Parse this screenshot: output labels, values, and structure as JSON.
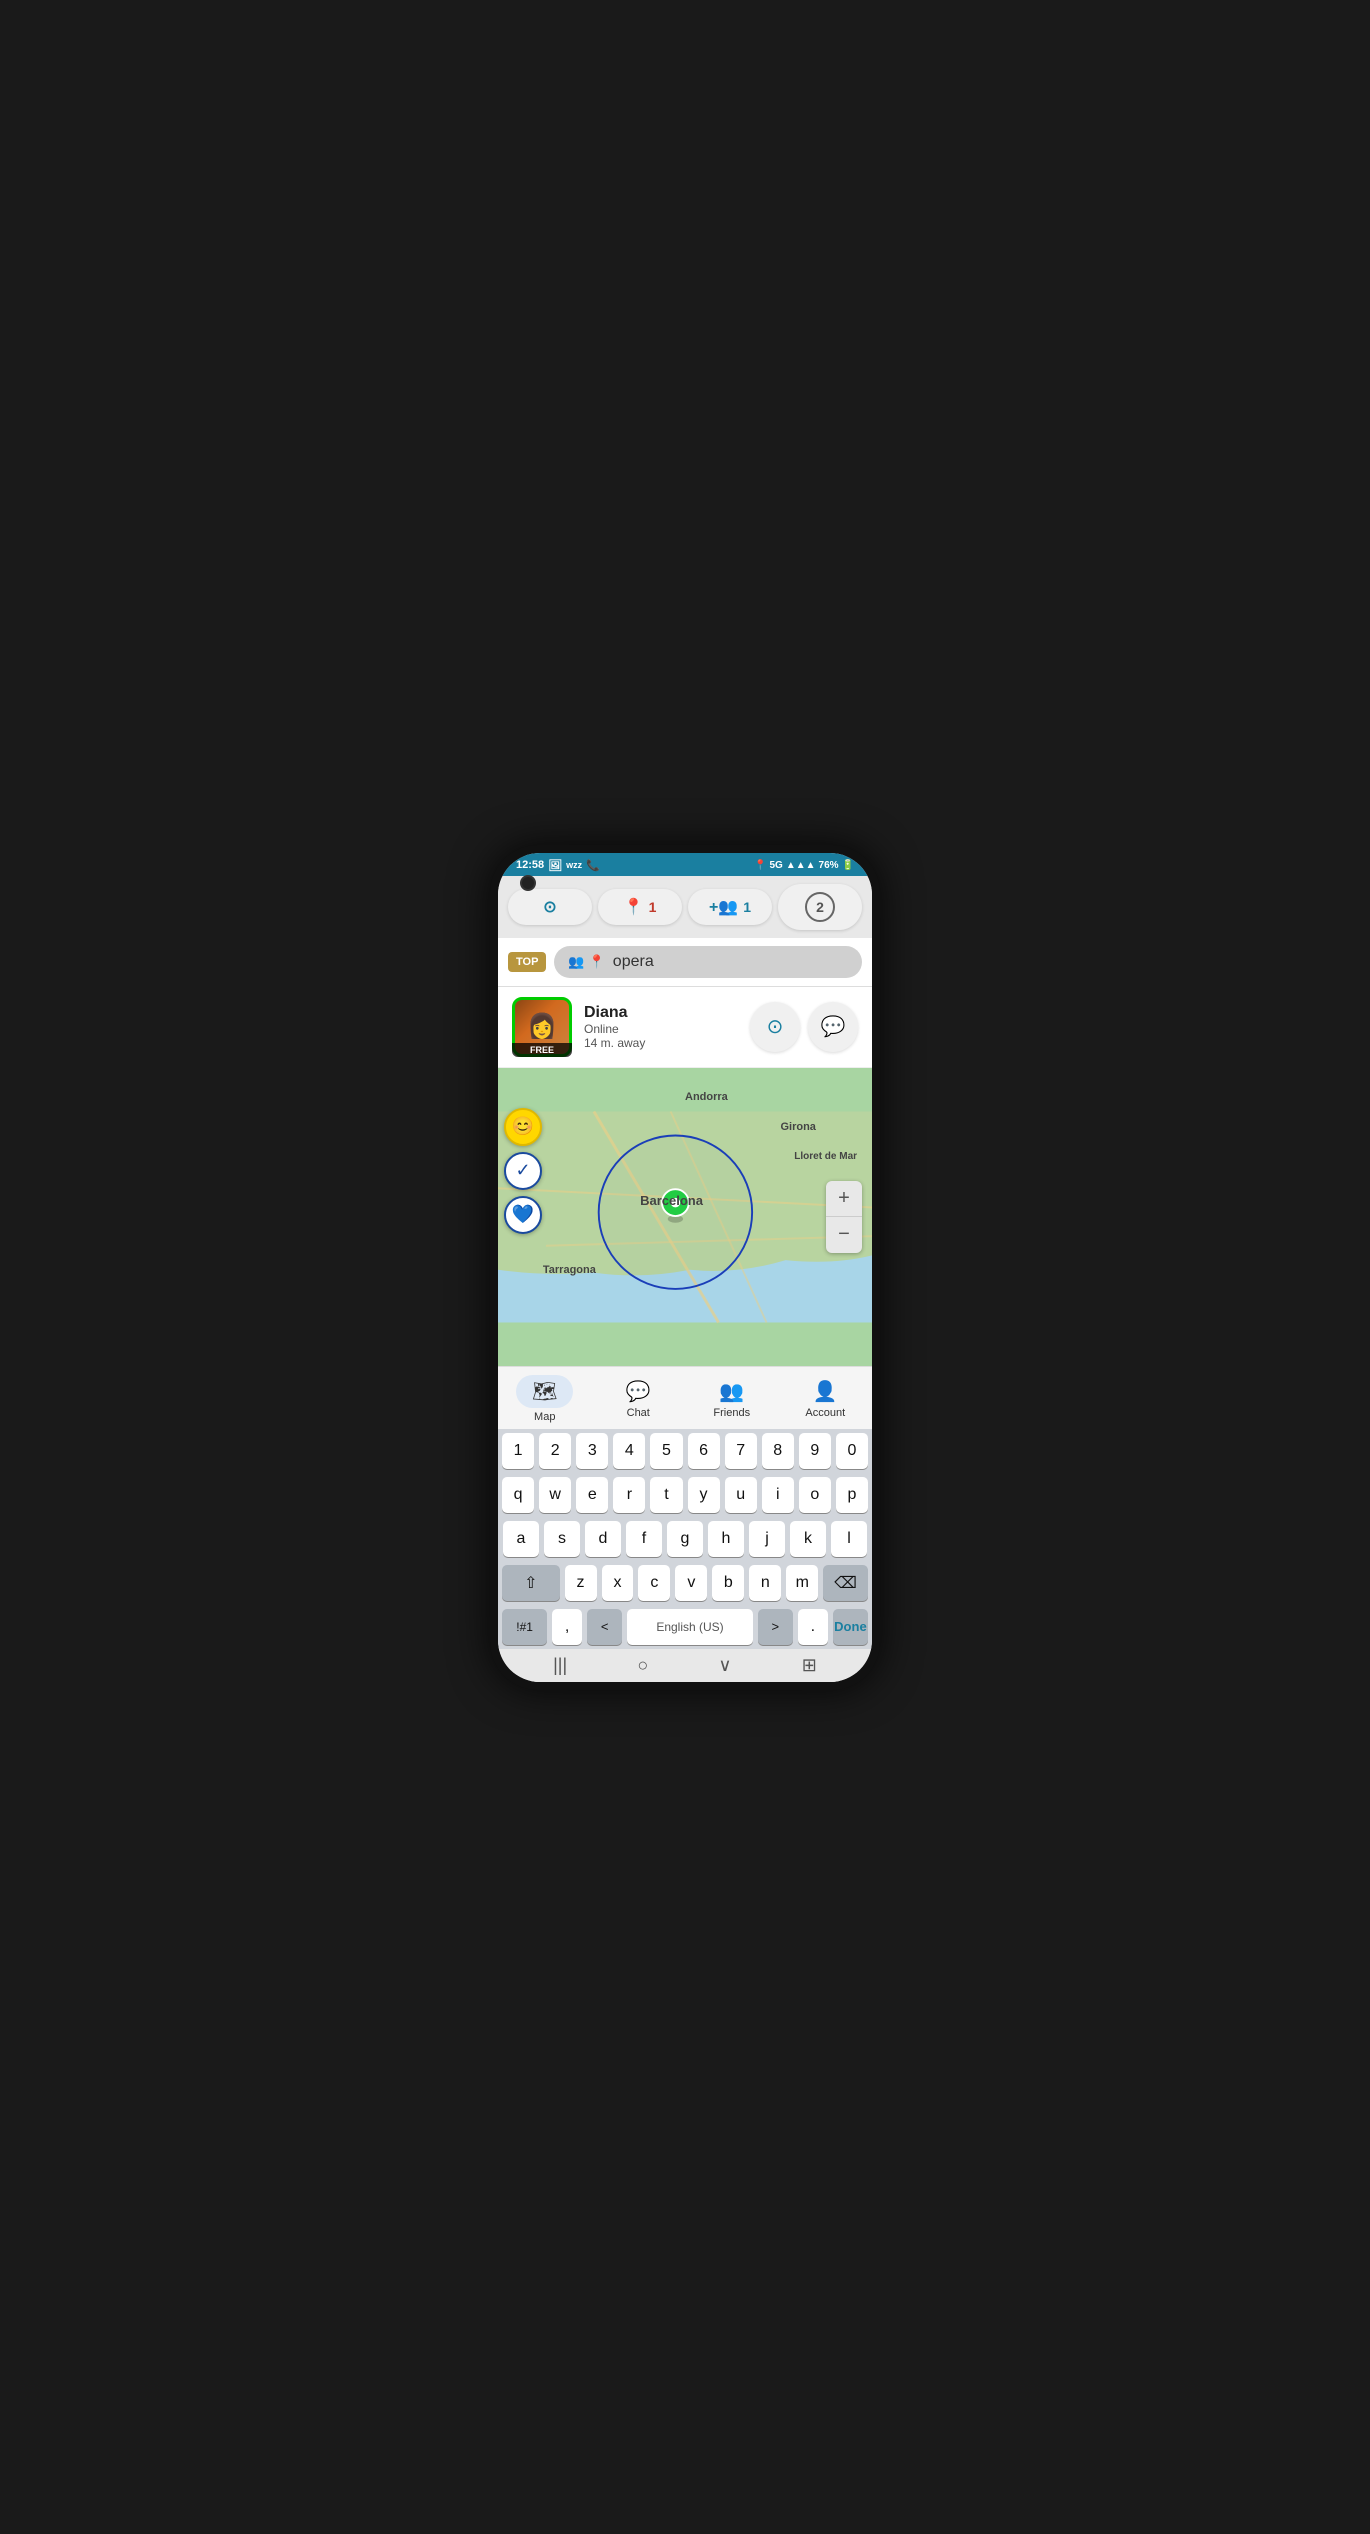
{
  "statusBar": {
    "time": "12:58",
    "battery": "76%",
    "signal": "5G"
  },
  "toolbar": {
    "scanLabel": "",
    "locationCount": "1",
    "addUserCount": "1",
    "notifCount": "2"
  },
  "search": {
    "topBadge": "TOP",
    "placeholder": "opera",
    "value": "opera"
  },
  "userCard": {
    "name": "Diana",
    "status": "Online",
    "distance": "14 m. away",
    "freeBadge": "FREE"
  },
  "map": {
    "labels": {
      "andorra": "Andorra",
      "girona": "Girona",
      "lloret": "Lloret de Mar",
      "barcelona": "Barcelona",
      "tarragona": "Tarragona"
    },
    "zoomPlus": "+",
    "zoomMinus": "−"
  },
  "navBar": {
    "items": [
      {
        "label": "Map",
        "icon": "🗺"
      },
      {
        "label": "Chat",
        "icon": "💬"
      },
      {
        "label": "Friends",
        "icon": "👥"
      },
      {
        "label": "Account",
        "icon": "👤"
      }
    ]
  },
  "keyboard": {
    "row1": [
      "1",
      "2",
      "3",
      "4",
      "5",
      "6",
      "7",
      "8",
      "9",
      "0"
    ],
    "row2": [
      "q",
      "w",
      "e",
      "r",
      "t",
      "y",
      "u",
      "i",
      "o",
      "p"
    ],
    "row3": [
      "a",
      "s",
      "d",
      "f",
      "g",
      "h",
      "j",
      "k",
      "l"
    ],
    "row4": [
      "z",
      "x",
      "c",
      "v",
      "b",
      "n",
      "m"
    ],
    "specialKeys": {
      "shift": "⇧",
      "backspace": "⌫",
      "sym": "!#1",
      "comma": ",",
      "langPrev": "<",
      "language": "English (US)",
      "langNext": ">",
      "period": ".",
      "done": "Done"
    }
  },
  "bottomNav": {
    "items": [
      "|||",
      "○",
      "∨",
      "⊞"
    ]
  }
}
